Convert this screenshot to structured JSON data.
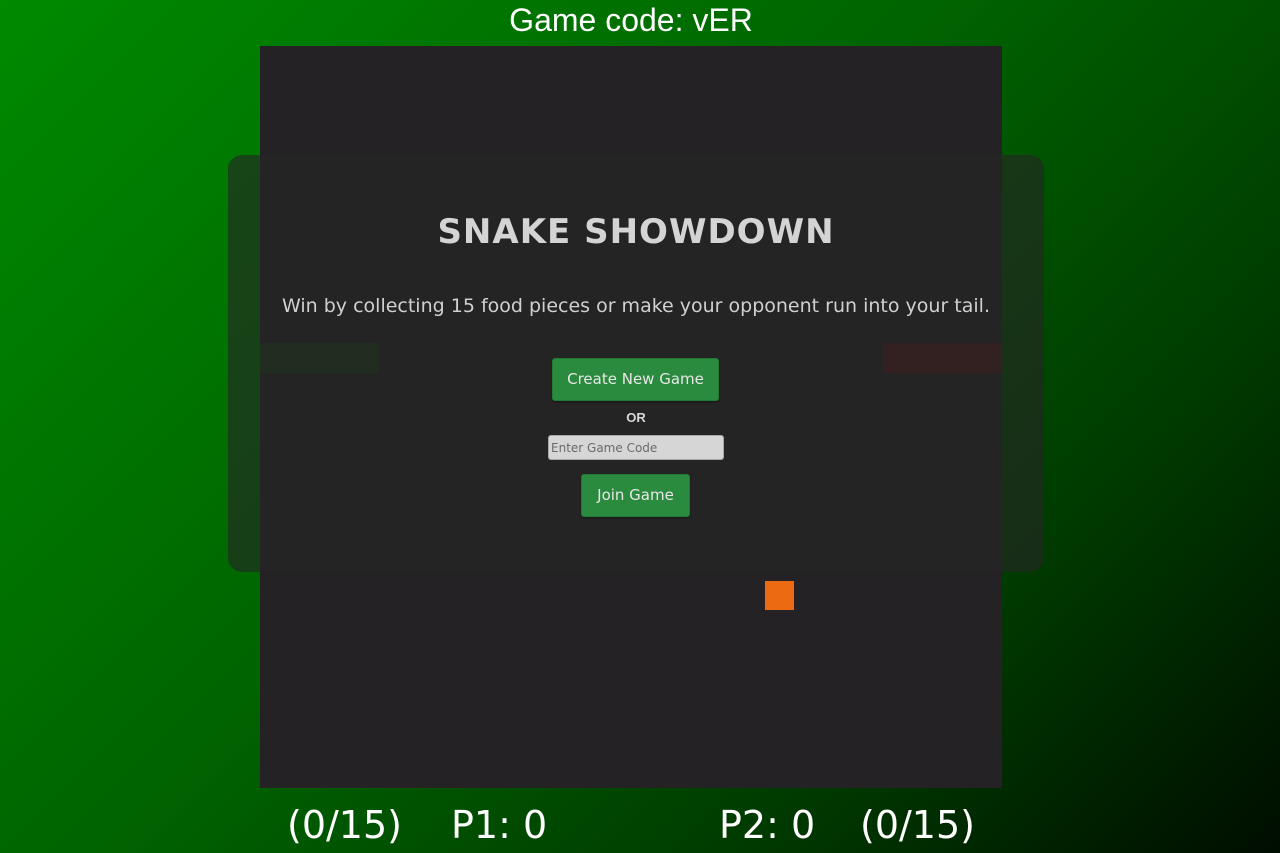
{
  "header": {
    "game_code_text": "Game code: vER"
  },
  "board": {
    "background_color": "#252225",
    "player1_snake_color": "#1d3a1e",
    "player2_snake_color": "#4a191a",
    "food_color": "#ec6a12"
  },
  "modal": {
    "title": "SNAKE SHOWDOWN",
    "description": "Win by collecting 15 food pieces or make your opponent run into your tail.",
    "create_button_label": "Create New Game",
    "or_label": "OR",
    "code_input_placeholder": "Enter Game Code",
    "code_input_value": "",
    "join_button_label": "Join Game",
    "accent_color": "#2a8a3d"
  },
  "scoreboard": {
    "p1_progress": "(0/15)",
    "p1_score": "P1: 0",
    "p2_score": "P2: 0",
    "p2_progress": "(0/15)"
  }
}
